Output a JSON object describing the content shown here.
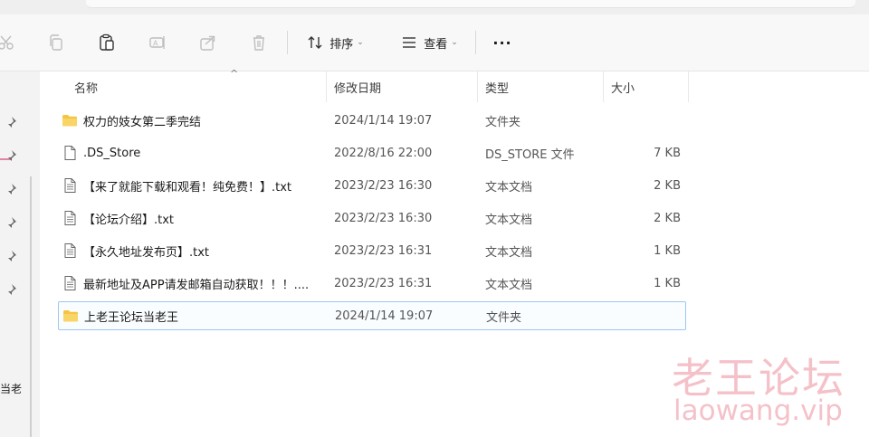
{
  "toolbar": {
    "sort_label": "排序",
    "view_label": "查看",
    "more_label": "···"
  },
  "columns": {
    "name": "名称",
    "modified": "修改日期",
    "type": "类型",
    "size": "大小"
  },
  "files": [
    {
      "name": "权力的妓女第二季完结",
      "modified": "2024/1/14 19:07",
      "type": "文件夹",
      "size": "",
      "icon": "folder-icon"
    },
    {
      "name": ".DS_Store",
      "modified": "2022/8/16 22:00",
      "type": "DS_STORE 文件",
      "size": "7 KB",
      "icon": "file-icon"
    },
    {
      "name": "【来了就能下载和观看！纯免费！】.txt",
      "modified": "2023/2/23 16:30",
      "type": "文本文档",
      "size": "2 KB",
      "icon": "text-file-icon"
    },
    {
      "name": "【论坛介绍】.txt",
      "modified": "2023/2/23 16:30",
      "type": "文本文档",
      "size": "2 KB",
      "icon": "text-file-icon"
    },
    {
      "name": "【永久地址发布页】.txt",
      "modified": "2023/2/23 16:31",
      "type": "文本文档",
      "size": "1 KB",
      "icon": "text-file-icon"
    },
    {
      "name": "最新地址及APP请发邮箱自动获取！！！....",
      "modified": "2023/2/23 16:31",
      "type": "文本文档",
      "size": "1 KB",
      "icon": "text-file-icon"
    },
    {
      "name": "上老王论坛当老王",
      "modified": "2024/1/14 19:07",
      "type": "文件夹",
      "size": "",
      "icon": "folder-icon"
    }
  ],
  "sidebar": {
    "partial_text": "当老"
  },
  "watermark": {
    "title": "老王论坛",
    "url": "laowang.vip"
  },
  "colors": {
    "folder": "#f5c542",
    "selection_border": "#9ec6f0",
    "watermark": "#e8788a"
  }
}
